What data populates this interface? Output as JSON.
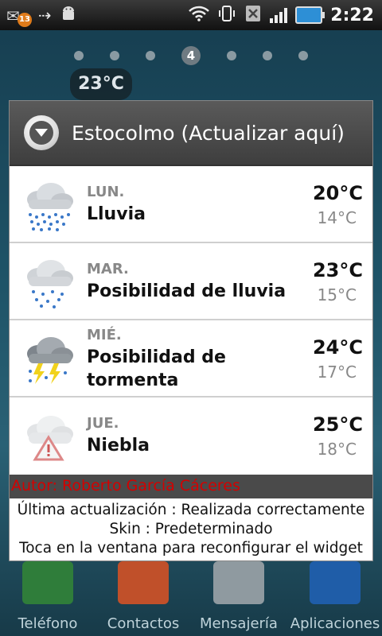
{
  "status_bar": {
    "notification_count": "13",
    "time": "2:22",
    "icons": [
      "notification-icon",
      "usb-icon",
      "android-debug-icon",
      "wifi-icon",
      "vibrate-icon",
      "no-sim-icon",
      "signal-icon",
      "battery-charging-icon"
    ]
  },
  "home": {
    "current_page": "4",
    "widget_temp": "23°C"
  },
  "dialog": {
    "title": "Estocolmo (Actualizar aquí)",
    "forecast": [
      {
        "day": "LUN.",
        "desc": "Lluvia",
        "high": "20°C",
        "low": "14°C",
        "icon": "rain-cloud-icon"
      },
      {
        "day": "MAR.",
        "desc": "Posibilidad de lluvia",
        "high": "23°C",
        "low": "15°C",
        "icon": "light-rain-cloud-icon"
      },
      {
        "day": "MIÉ.",
        "desc": "Posibilidad de tormenta",
        "high": "24°C",
        "low": "17°C",
        "icon": "storm-cloud-icon"
      },
      {
        "day": "JUE.",
        "desc": "Niebla",
        "high": "25°C",
        "low": "18°C",
        "icon": "fog-warning-icon"
      }
    ],
    "author": "Autor: Roberto García Cáceres",
    "info_lines": [
      "Última actualización : Realizada correctamente",
      "Skin : Predeterminado",
      "Toca en la ventana para reconfigurar el widget"
    ]
  },
  "dock": {
    "apps": [
      {
        "label": "Teléfono",
        "color": "#2f7d3a"
      },
      {
        "label": "Contactos",
        "color": "#c0502a"
      },
      {
        "label": "Mensajería",
        "color": "#8f9aa0"
      },
      {
        "label": "Aplicaciones",
        "color": "#1f5da8"
      }
    ]
  }
}
